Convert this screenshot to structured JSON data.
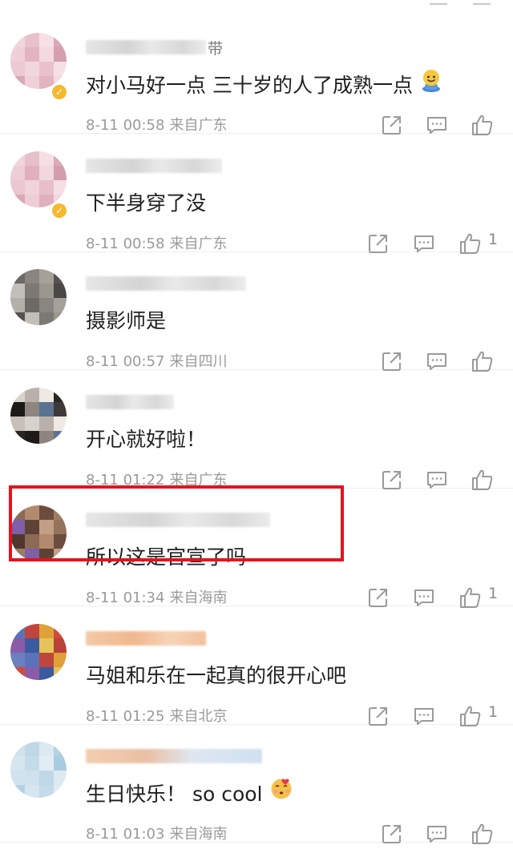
{
  "comments": [
    {
      "username_suffix": "带",
      "text": "对小马好一点 三十岁的人了成熟一点",
      "emoji": "smiling-face-emoji",
      "verified": true,
      "date": "8-11 00:58",
      "location": "来自广东",
      "likes": "",
      "avatar_colors": [
        "#f2d6dd",
        "#e8c1cb",
        "#f6e0e6",
        "#d9a8b6",
        "#efcfd8",
        "#e2b3c1",
        "#f3d9e0",
        "#d49fae",
        "#ecc9d3"
      ]
    },
    {
      "username_suffix": "",
      "text": "下半身穿了没",
      "emoji": "",
      "verified": true,
      "date": "8-11 00:58",
      "location": "来自广东",
      "likes": "1",
      "avatar_colors": [
        "#f0d3db",
        "#e6bfc9",
        "#f5dee4",
        "#dba9b7",
        "#edcdd6",
        "#e0b0be",
        "#f2d7de",
        "#d29dac",
        "#eac7d1"
      ]
    },
    {
      "username_suffix": "",
      "text": "摄影师是",
      "emoji": "",
      "verified": false,
      "date": "8-11 00:57",
      "location": "来自四川",
      "likes": "",
      "avatar_colors": [
        "#6d6a66",
        "#8a8580",
        "#a5a09a",
        "#55524f",
        "#c2bfbb",
        "#7c7873",
        "#9b978f",
        "#4a4846",
        "#b3afa9"
      ]
    },
    {
      "username_suffix": "",
      "text": "开心就好啦！",
      "emoji": "",
      "verified": false,
      "date": "8-11 01:22",
      "location": "来自广东",
      "likes": "",
      "avatar_colors": [
        "#d8d2cc",
        "#b9b0a9",
        "#efe9e4",
        "#2b2623",
        "#1d1a18",
        "#8e857e",
        "#5a7390",
        "#3d3a38",
        "#c7bfb8"
      ]
    },
    {
      "username_suffix": "",
      "text": "所以这是官宣了吗",
      "emoji": "",
      "verified": false,
      "date": "8-11 01:34",
      "location": "来自海南",
      "likes": "1",
      "avatar_colors": [
        "#8c6a55",
        "#b38a6e",
        "#6b4c3d",
        "#a07b63",
        "#7e5fa8",
        "#5d4235",
        "#c29f84",
        "#94725c",
        "#4e382d"
      ]
    },
    {
      "username_suffix": "",
      "text": "马姐和乐在一起真的很开心吧",
      "emoji": "",
      "verified": false,
      "date": "8-11 01:25",
      "location": "来自北京",
      "likes": "1",
      "avatar_colors": [
        "#5a73b8",
        "#c0453d",
        "#e0a03a",
        "#d24a3c",
        "#8a5ca8",
        "#3b5aa0",
        "#e6c35a",
        "#b8423a",
        "#6a80c0"
      ]
    },
    {
      "username_suffix": "",
      "text": "生日快乐！ so cool",
      "emoji": "heart-kiss-face-emoji",
      "verified": false,
      "date": "8-11 01:03",
      "location": "来自海南",
      "likes": "",
      "avatar_colors": [
        "#cfe1ec",
        "#bfd8e8",
        "#dce9f1",
        "#b3d1e4",
        "#d6e6ef",
        "#c4dbe9",
        "#e1edf3",
        "#aacce2",
        "#d0e2ed"
      ]
    }
  ],
  "highlight_color": "#e6121c"
}
